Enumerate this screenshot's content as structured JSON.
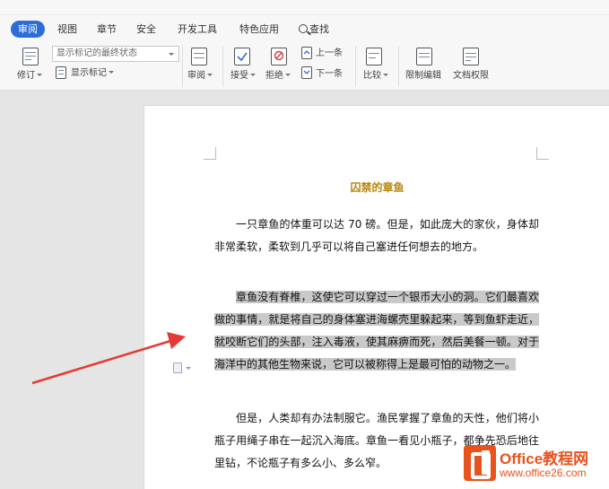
{
  "tabs": [
    {
      "label": "审阅",
      "active": true
    },
    {
      "label": "视图"
    },
    {
      "label": "章节"
    },
    {
      "label": "安全"
    },
    {
      "label": "开发工具"
    },
    {
      "label": "特色应用"
    },
    {
      "label": "查找",
      "icon": "search-icon"
    }
  ],
  "ribbon": {
    "track_changes": "修订",
    "markup_dropdown": "显示标记的最终状态",
    "show_markup": "显示标记",
    "review": "审阅",
    "accept": "接受",
    "reject": "拒绝",
    "previous": "上一条",
    "next": "下一条",
    "compare": "比较",
    "restrict_editing": "限制编辑",
    "doc_permissions": "文档权限"
  },
  "document": {
    "title": "囚禁的章鱼",
    "p1": "一只章鱼的体重可以达 70 磅。但是，如此庞大的家伙，身体却非常柔软，柔软到几乎可以将自己塞进任何想去的地方。",
    "p2": "章鱼没有脊椎，这使它可以穿过一个银币大小的洞。它们最喜欢做的事情，就是将自己的身体塞进海螺壳里躲起来，等到鱼虾走近，就咬断它们的头部，注入毒液，使其麻痹而死，然后美餐一顿。对于海洋中的其他生物来说，它可以被称得上是最可怕的动物之一。",
    "p3": "但是，人类却有办法制服它。渔民掌握了章鱼的天性，他们将小瓶子用绳子串在一起沉入海底。章鱼一看见小瓶子，都争先恐后地往里钻，不论瓶子有多么小、多么窄。"
  },
  "watermark": {
    "brand": "Office教程网",
    "url": "www.office26.com"
  },
  "colors": {
    "active_tab": "#2b6dd9",
    "title": "#b8860b",
    "highlight": "#c9c9c9",
    "annotation_arrow": "#e53935",
    "watermark": "#e8521c"
  }
}
